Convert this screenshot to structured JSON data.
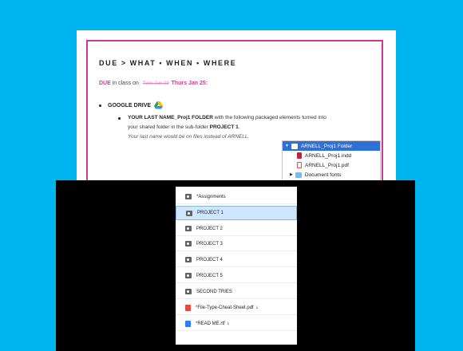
{
  "document": {
    "heading": {
      "due": "DUE",
      "arrow": ">",
      "what": "WHAT",
      "dot": "•",
      "when": "WHEN",
      "where": "WHERE"
    },
    "due_line": {
      "label": "DUE",
      "text": " in class on ",
      "struck": "Tues Jan 23",
      "date": "Thurs Jan 25",
      "colon": ":"
    },
    "google_drive": "GOOGLE DRIVE",
    "instruction": {
      "bold": "YOUR LAST NAME_Proj1 FOLDER",
      "rest": " with the following packaged elements turned into",
      "line2_pre": "your shared folder in the sub-folder ",
      "line2_bold": "PROJECT 1",
      "line2_end": ".",
      "line3": "Your last name would be on files instead of ARNELL."
    },
    "finder": {
      "folder": "ARNELL_Proj1 Folder",
      "files": [
        "ARNELL_Proj1.indd",
        "ARNELL_Proj1.pdf"
      ],
      "subfolder": "Document fonts"
    }
  },
  "drive": {
    "items": [
      {
        "label": "*Assignments",
        "icon": "shared-folder-icon"
      },
      {
        "label": "PROJECT 1",
        "icon": "shared-folder-icon",
        "selected": true
      },
      {
        "label": "PROJECT 2",
        "icon": "shared-folder-icon"
      },
      {
        "label": "PROJECT 3",
        "icon": "shared-folder-icon"
      },
      {
        "label": "PROJECT 4",
        "icon": "shared-folder-icon"
      },
      {
        "label": "PROJECT 5",
        "icon": "shared-folder-icon"
      },
      {
        "label": "SECOND TRIES",
        "icon": "shared-folder-icon"
      },
      {
        "label": "*File-Type-Cheat-Sheet.pdf",
        "icon": "pdf-icon",
        "mark": "ﾑ"
      },
      {
        "label": "*READ ME.rtf",
        "icon": "doc-icon",
        "mark": "ﾑ"
      }
    ]
  },
  "colors": {
    "background": "#00b4f0",
    "accent": "#d1359a",
    "selection": "#2f6fd6"
  }
}
